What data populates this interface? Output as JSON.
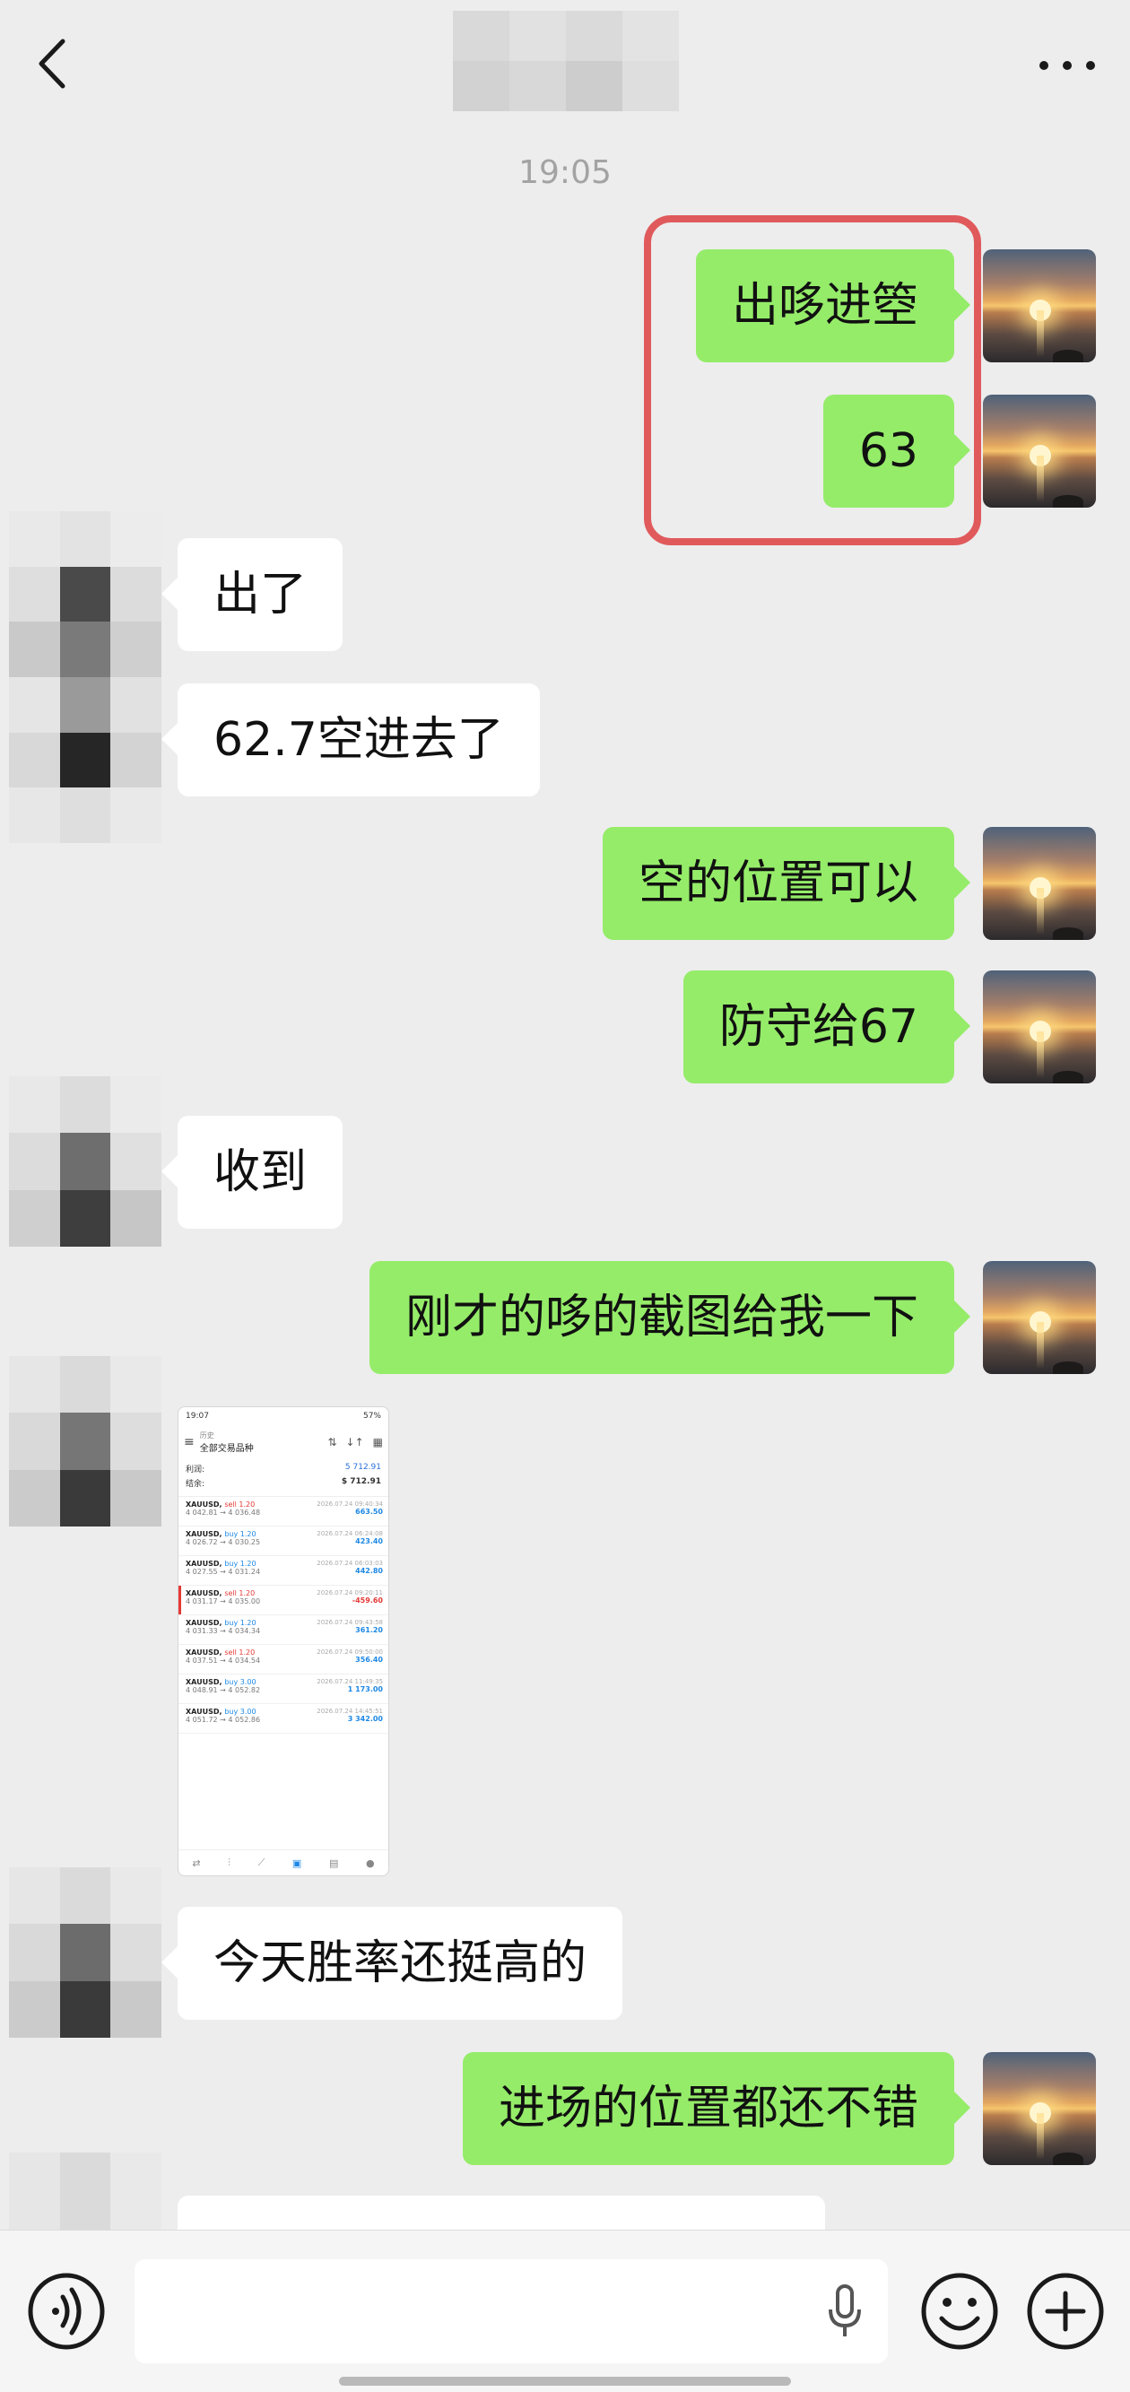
{
  "header": {
    "title": ""
  },
  "chat": {
    "timestamp": "19:05",
    "messages": [
      {
        "id": "m1",
        "sender": "me",
        "text": "出哆进箜"
      },
      {
        "id": "m2",
        "sender": "me",
        "text": "63"
      },
      {
        "id": "m3",
        "sender": "other",
        "text": "出了"
      },
      {
        "id": "m4",
        "sender": "other",
        "text": "62.7空进去了"
      },
      {
        "id": "m5",
        "sender": "me",
        "text": "空的位置可以"
      },
      {
        "id": "m6",
        "sender": "me",
        "text": "防守给67"
      },
      {
        "id": "m7",
        "sender": "other",
        "text": "收到"
      },
      {
        "id": "m8",
        "sender": "me",
        "text": "刚才的哆的截图给我一下"
      },
      {
        "id": "m9",
        "sender": "other",
        "type": "image"
      },
      {
        "id": "m10",
        "sender": "other",
        "text": "今天胜率还挺高的"
      },
      {
        "id": "m11",
        "sender": "me",
        "text": "进场的位置都还不错"
      },
      {
        "id": "m12",
        "sender": "other",
        "text": ""
      }
    ]
  },
  "screenshot": {
    "status_time": "19:07",
    "status_right": "57%",
    "tab_small": "历史",
    "tab_title": "全部交易品种",
    "profit_label": "利润:",
    "profit_value": "5 712.91",
    "balance_label": "结余:",
    "balance_value": "$ 712.91",
    "trades": [
      {
        "symbol": "XAUUSD,",
        "side": "sell 1.20",
        "prices": "4 042.81 → 4 036.48",
        "date": "2026.07.24 09:40:34",
        "profit": "663.50"
      },
      {
        "symbol": "XAUUSD,",
        "side": "buy 1.20",
        "prices": "4 026.72 → 4 030.25",
        "date": "2026.07.24 06:24:08",
        "profit": "423.40"
      },
      {
        "symbol": "XAUUSD,",
        "side": "buy 1.20",
        "prices": "4 027.55 → 4 031.24",
        "date": "2026.07.24 06:03:03",
        "profit": "442.80"
      },
      {
        "symbol": "XAUUSD,",
        "side": "sell 1.20",
        "prices": "4 031.17 → 4 035.00",
        "date": "2026.07.24 09:20:11",
        "profit": "-459.60"
      },
      {
        "symbol": "XAUUSD,",
        "side": "buy 1.20",
        "prices": "4 031.33 → 4 034.34",
        "date": "2026.07.24 09:43:58",
        "profit": "361.20"
      },
      {
        "symbol": "XAUUSD,",
        "side": "sell 1.20",
        "prices": "4 037.51 → 4 034.54",
        "date": "2026.07.24 09:50:00",
        "profit": "356.40"
      },
      {
        "symbol": "XAUUSD,",
        "side": "buy 3.00",
        "prices": "4 048.91 → 4 052.82",
        "date": "2026.07.24 11:49:35",
        "profit": "1 173.00"
      },
      {
        "symbol": "XAUUSD,",
        "side": "buy 3.00",
        "prices": "4 051.72 → 4 052.86",
        "date": "2026.07.24 14:45:51",
        "profit": "3 342.00"
      }
    ]
  },
  "icons": {
    "back": "chevron-left-icon",
    "more": "more-horizontal-icon",
    "voice": "voice-icon",
    "mic": "microphone-icon",
    "emoji": "emoji-icon",
    "plus": "plus-circle-icon"
  },
  "colors": {
    "background": "#ededed",
    "my_bubble": "#95ec69",
    "other_bubble": "#ffffff",
    "highlight": "#e05a5c",
    "timestamp": "#a3a3a3"
  },
  "input": {
    "placeholder": ""
  }
}
